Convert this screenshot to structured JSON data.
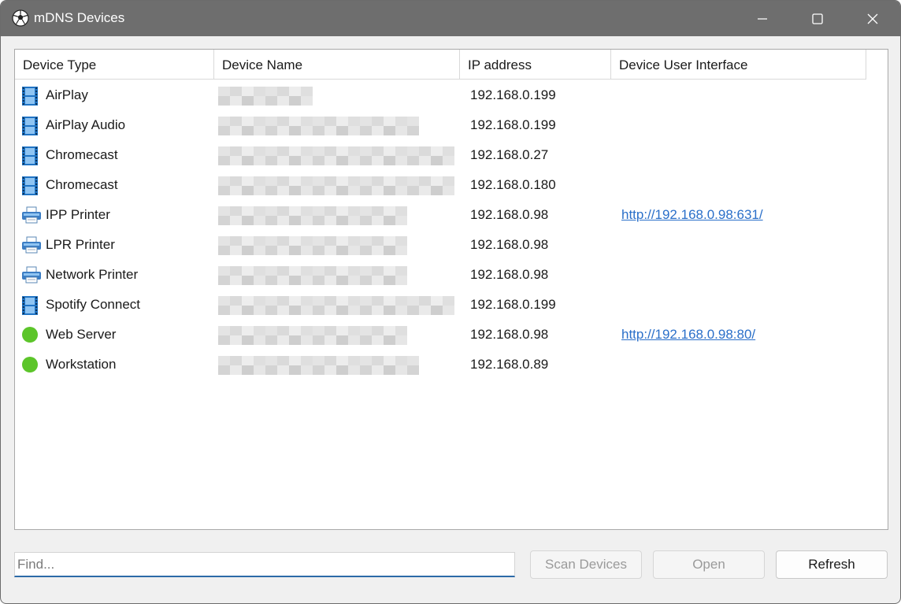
{
  "window": {
    "title": "mDNS Devices",
    "icon": "soccer-ball-icon"
  },
  "table": {
    "columns": [
      "Device Type",
      "Device Name",
      "IP address",
      "Device User Interface"
    ],
    "rows": [
      {
        "icon": "film-strip-icon",
        "type": "AirPlay",
        "ip": "192.168.0.199",
        "ui": ""
      },
      {
        "icon": "film-strip-icon",
        "type": "AirPlay Audio",
        "ip": "192.168.0.199",
        "ui": ""
      },
      {
        "icon": "film-strip-icon",
        "type": "Chromecast",
        "ip": "192.168.0.27",
        "ui": ""
      },
      {
        "icon": "film-strip-icon",
        "type": "Chromecast",
        "ip": "192.168.0.180",
        "ui": ""
      },
      {
        "icon": "printer-icon",
        "type": "IPP Printer",
        "ip": "192.168.0.98",
        "ui": "http://192.168.0.98:631/"
      },
      {
        "icon": "printer-icon",
        "type": "LPR Printer",
        "ip": "192.168.0.98",
        "ui": ""
      },
      {
        "icon": "printer-icon",
        "type": "Network Printer",
        "ip": "192.168.0.98",
        "ui": ""
      },
      {
        "icon": "film-strip-icon",
        "type": "Spotify Connect",
        "ip": "192.168.0.199",
        "ui": ""
      },
      {
        "icon": "green-dot-icon",
        "type": "Web Server",
        "ip": "192.168.0.98",
        "ui": "http://192.168.0.98:80/"
      },
      {
        "icon": "green-dot-icon",
        "type": "Workstation",
        "ip": "192.168.0.89",
        "ui": ""
      }
    ]
  },
  "footer": {
    "find_placeholder": "Find...",
    "scan_label": "Scan Devices",
    "open_label": "Open",
    "refresh_label": "Refresh"
  },
  "colors": {
    "titlebar": "#6e6e6e",
    "link": "#2a6fc9",
    "film_icon": "#1f74c6",
    "green_dot": "#5cc52a",
    "find_underline": "#2c6aa8"
  }
}
